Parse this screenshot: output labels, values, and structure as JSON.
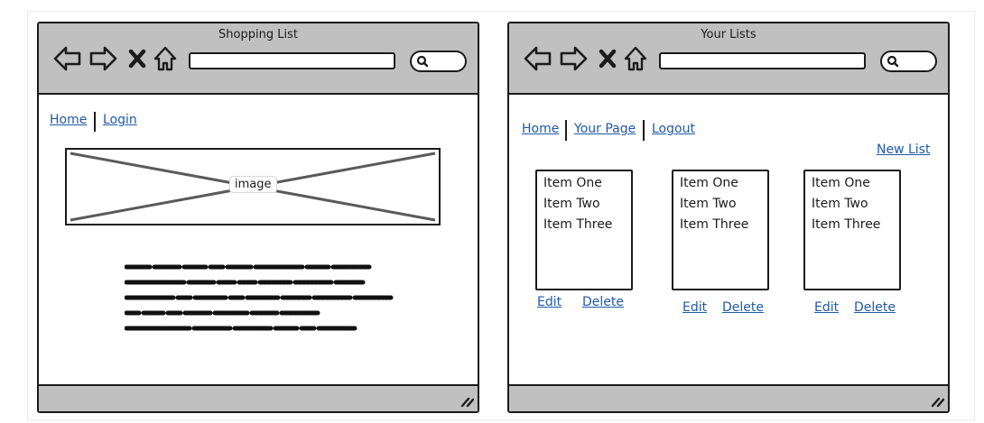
{
  "left_window": {
    "title": "Shopping List",
    "nav": {
      "home": "Home",
      "login": "Login"
    },
    "image_label": "image"
  },
  "right_window": {
    "title": "Your Lists",
    "nav": {
      "home": "Home",
      "your_page": "Your Page",
      "logout": "Logout"
    },
    "new_list": "New List",
    "lists": [
      {
        "items": [
          "Item One",
          "Item Two",
          "Item Three"
        ],
        "edit": "Edit",
        "delete": "Delete"
      },
      {
        "items": [
          "Item One",
          "Item Two",
          "Item Three"
        ],
        "edit": "Edit",
        "delete": "Delete"
      },
      {
        "items": [
          "Item One",
          "Item Two",
          "Item Three"
        ],
        "edit": "Edit",
        "delete": "Delete"
      }
    ]
  },
  "colors": {
    "chrome": "#c0c0c0",
    "outline": "#1b1b1b",
    "link": "#1f5aa6",
    "placeholder_line": "#5a5a5a"
  },
  "icons": [
    "back-arrow-icon",
    "forward-arrow-icon",
    "close-icon",
    "home-icon",
    "search-icon",
    "resize-grip-icon"
  ]
}
